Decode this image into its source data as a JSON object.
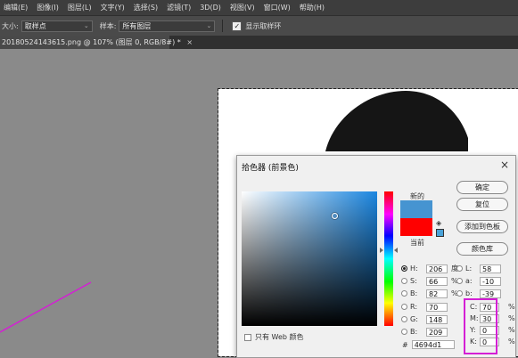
{
  "menu": [
    "编辑(E)",
    "图像(I)",
    "图层(L)",
    "文字(Y)",
    "选择(S)",
    "滤镜(T)",
    "3D(D)",
    "视图(V)",
    "窗口(W)",
    "帮助(H)"
  ],
  "options": {
    "size_label": "大小:",
    "size_value": "取样点",
    "sample_label": "样本:",
    "sample_value": "所有图层",
    "show_ring_label": "显示取样环",
    "show_ring_checked": "✓"
  },
  "tab": {
    "title": "20180524143615.png @ 107% (图层 0, RGB/8#) *",
    "close": "×"
  },
  "colors": {
    "accent_pink": "#d41fd4",
    "new_color": "#4694d1",
    "current_color": "#ff0000"
  },
  "dialog": {
    "title": "拾色器 (前景色)",
    "close": "×",
    "label_new": "新的",
    "label_current": "当前",
    "buttons": {
      "ok": "确定",
      "reset": "复位",
      "add_swatch": "添加到色板",
      "libraries": "颜色库"
    },
    "hsb": [
      {
        "label": "H:",
        "value": "206",
        "unit": "度",
        "selected": true
      },
      {
        "label": "S:",
        "value": "66",
        "unit": "%",
        "selected": false
      },
      {
        "label": "B:",
        "value": "82",
        "unit": "%",
        "selected": false
      }
    ],
    "rgb": [
      {
        "label": "R:",
        "value": "70"
      },
      {
        "label": "G:",
        "value": "148"
      },
      {
        "label": "B:",
        "value": "209"
      }
    ],
    "lab": [
      {
        "label": "L:",
        "value": "58"
      },
      {
        "label": "a:",
        "value": "-10"
      },
      {
        "label": "b:",
        "value": "-39"
      }
    ],
    "cmyk": [
      {
        "label": "C:",
        "value": "70",
        "unit": "%"
      },
      {
        "label": "M:",
        "value": "30",
        "unit": "%"
      },
      {
        "label": "Y:",
        "value": "0",
        "unit": "%"
      },
      {
        "label": "K:",
        "value": "0",
        "unit": "%"
      }
    ],
    "hex_label": "#",
    "hex_value": "4694d1",
    "web_only_label": "只有 Web 颜色"
  }
}
